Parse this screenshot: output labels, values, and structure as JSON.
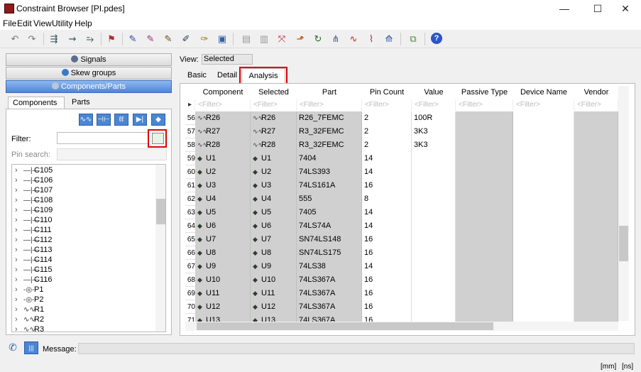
{
  "window": {
    "title": "Constraint Browser [PI.pdes]",
    "minimize": "—",
    "maximize": "☐",
    "close": "✕"
  },
  "menu": [
    "File",
    "Edit",
    "View",
    "Utility",
    "Help"
  ],
  "nav": {
    "signals": "Signals",
    "skew_groups": "Skew groups",
    "components_parts": "Components/Parts"
  },
  "left_tabs": {
    "components": "Components",
    "parts": "Parts"
  },
  "filter": {
    "label": "Filter:",
    "value": ""
  },
  "pin_search": {
    "label": "Pin search:",
    "value": ""
  },
  "tree_items": [
    {
      "label": "C105",
      "sym": "—|—"
    },
    {
      "label": "C106",
      "sym": "—|—"
    },
    {
      "label": "C107",
      "sym": "—|—"
    },
    {
      "label": "C108",
      "sym": "—|—"
    },
    {
      "label": "C109",
      "sym": "—|—"
    },
    {
      "label": "C110",
      "sym": "—|—"
    },
    {
      "label": "C111",
      "sym": "—|—"
    },
    {
      "label": "C112",
      "sym": "—|—"
    },
    {
      "label": "C113",
      "sym": "—|—"
    },
    {
      "label": "C114",
      "sym": "—|—"
    },
    {
      "label": "C115",
      "sym": "—|—"
    },
    {
      "label": "C116",
      "sym": "—|—"
    },
    {
      "label": "P1",
      "sym": "-◎-"
    },
    {
      "label": "P2",
      "sym": "-◎-"
    },
    {
      "label": "R1",
      "sym": "∿∿"
    },
    {
      "label": "R2",
      "sym": "∿∿"
    },
    {
      "label": "R3",
      "sym": "∿∿"
    }
  ],
  "view": {
    "label": "View:",
    "selected": "Selected"
  },
  "right_tabs": {
    "basic": "Basic",
    "detail": "Detail",
    "analysis": "Analysis"
  },
  "grid": {
    "columns": [
      "Component",
      "Selected",
      "Part",
      "Pin Count",
      "Value",
      "Passive Type",
      "Device Name",
      "Vendor"
    ],
    "filter_placeholder": "<Filter>",
    "rows": [
      {
        "n": "56",
        "type": "R",
        "component": "R26",
        "selected": "R26",
        "part": "R26_7FEMC",
        "pins": "2",
        "value": "100R"
      },
      {
        "n": "57",
        "type": "R",
        "component": "R27",
        "selected": "R27",
        "part": "R3_32FEMC",
        "pins": "2",
        "value": "3K3"
      },
      {
        "n": "58",
        "type": "R",
        "component": "R28",
        "selected": "R28",
        "part": "R3_32FEMC",
        "pins": "2",
        "value": "3K3"
      },
      {
        "n": "59",
        "type": "U",
        "component": "U1",
        "selected": "U1",
        "part": "7404",
        "pins": "14",
        "value": ""
      },
      {
        "n": "60",
        "type": "U",
        "component": "U2",
        "selected": "U2",
        "part": "74LS393",
        "pins": "14",
        "value": ""
      },
      {
        "n": "61",
        "type": "U",
        "component": "U3",
        "selected": "U3",
        "part": "74LS161A",
        "pins": "16",
        "value": ""
      },
      {
        "n": "62",
        "type": "U",
        "component": "U4",
        "selected": "U4",
        "part": "555",
        "pins": "8",
        "value": ""
      },
      {
        "n": "63",
        "type": "U",
        "component": "U5",
        "selected": "U5",
        "part": "7405",
        "pins": "14",
        "value": ""
      },
      {
        "n": "64",
        "type": "U",
        "component": "U6",
        "selected": "U6",
        "part": "74LS74A",
        "pins": "14",
        "value": ""
      },
      {
        "n": "65",
        "type": "U",
        "component": "U7",
        "selected": "U7",
        "part": "SN74LS148",
        "pins": "16",
        "value": ""
      },
      {
        "n": "66",
        "type": "U",
        "component": "U8",
        "selected": "U8",
        "part": "SN74LS175",
        "pins": "16",
        "value": ""
      },
      {
        "n": "67",
        "type": "U",
        "component": "U9",
        "selected": "U9",
        "part": "74LS38",
        "pins": "14",
        "value": ""
      },
      {
        "n": "68",
        "type": "U",
        "component": "U10",
        "selected": "U10",
        "part": "74LS367A",
        "pins": "16",
        "value": ""
      },
      {
        "n": "69",
        "type": "U",
        "component": "U11",
        "selected": "U11",
        "part": "74LS367A",
        "pins": "16",
        "value": ""
      },
      {
        "n": "70",
        "type": "U",
        "component": "U12",
        "selected": "U12",
        "part": "74LS367A",
        "pins": "16",
        "value": ""
      },
      {
        "n": "71",
        "type": "U",
        "component": "U13",
        "selected": "U13",
        "part": "74LS367A",
        "pins": "16",
        "value": ""
      }
    ]
  },
  "status": {
    "message_label": "Message:",
    "message": "",
    "unit_length": "[mm]",
    "unit_time": "[ns]"
  },
  "colors": {
    "highlight": "#e00000",
    "accent": "#4a86d4",
    "shade": "#d0d0d0"
  }
}
